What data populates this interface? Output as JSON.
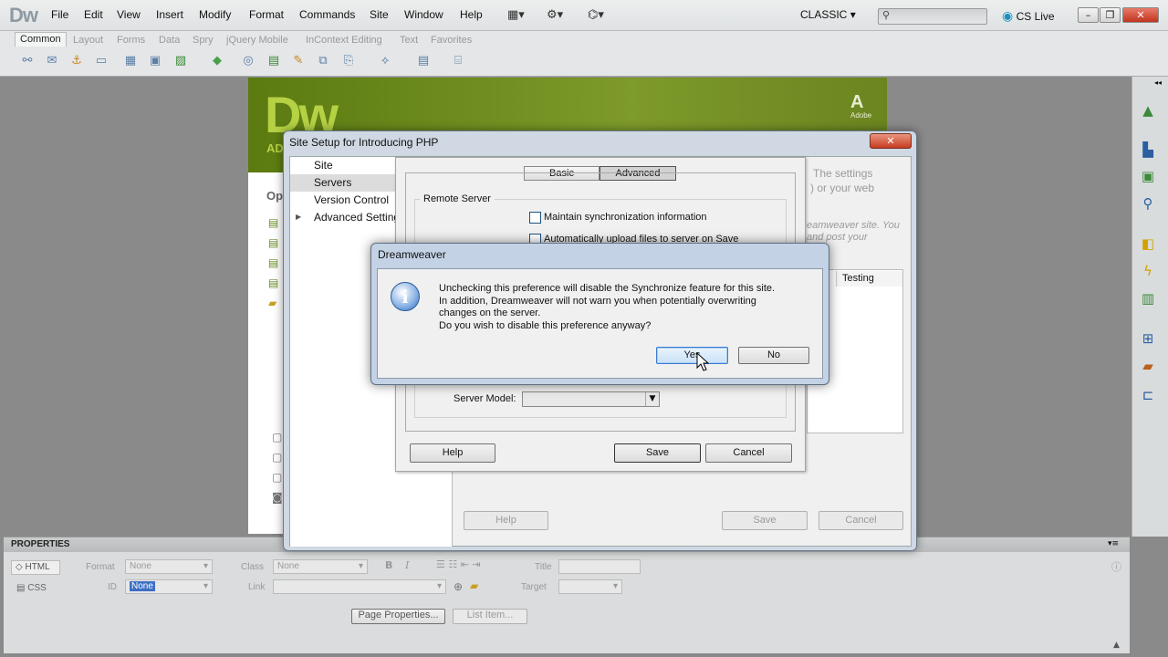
{
  "app": {
    "logo": "Dw",
    "menu": [
      "File",
      "Edit",
      "View",
      "Insert",
      "Modify",
      "Format",
      "Commands",
      "Site",
      "Window",
      "Help"
    ],
    "workspace": "CLASSIC",
    "cs_live": "CS Live"
  },
  "insert_bar": {
    "tabs": [
      "Common",
      "Layout",
      "Forms",
      "Data",
      "Spry",
      "jQuery Mobile",
      "InContext Editing",
      "Text",
      "Favorites"
    ],
    "active_tab": "Common"
  },
  "welcome": {
    "logo": "Dw",
    "sub": "AD",
    "open_label": "Op",
    "adobe": "Adobe"
  },
  "site_setup": {
    "title": "Site Setup for Introducing PHP",
    "categories": [
      {
        "label": "Site",
        "selected": false
      },
      {
        "label": "Servers",
        "selected": true
      },
      {
        "label": "Version Control",
        "selected": false
      },
      {
        "label": "Advanced Settings",
        "selected": false
      }
    ],
    "background_text": [
      "The settings",
      ") or your web",
      "eamweaver site. You",
      "and post your"
    ],
    "testing_header": "Testing",
    "help": "Help",
    "save": "Save",
    "cancel": "Cancel"
  },
  "remote_server": {
    "tabs": {
      "basic": "Basic",
      "advanced": "Advanced"
    },
    "active_tab": "Advanced",
    "group_label": "Remote Server",
    "maintain_sync": "Maintain synchronization information",
    "auto_upload": "Automatically upload files to server on Save",
    "server_model_label": "Server Model:",
    "server_model_value": "",
    "help": "Help",
    "save": "Save",
    "cancel": "Cancel"
  },
  "alert": {
    "title": "Dreamweaver",
    "line1": "Unchecking this preference will disable the Synchronize feature for this site.",
    "line2": "In addition, Dreamweaver will not warn you when potentially overwriting",
    "line3": "changes on the server.",
    "line4": "Do you wish to disable this preference anyway?",
    "yes": "Yes",
    "no": "No"
  },
  "properties": {
    "header": "PROPERTIES",
    "html": "HTML",
    "css": "CSS",
    "format_label": "Format",
    "format_value": "None",
    "class_label": "Class",
    "class_value": "None",
    "id_label": "ID",
    "id_value": "None",
    "link_label": "Link",
    "title_label": "Title",
    "target_label": "Target",
    "page_properties": "Page Properties...",
    "list_item": "List Item..."
  }
}
